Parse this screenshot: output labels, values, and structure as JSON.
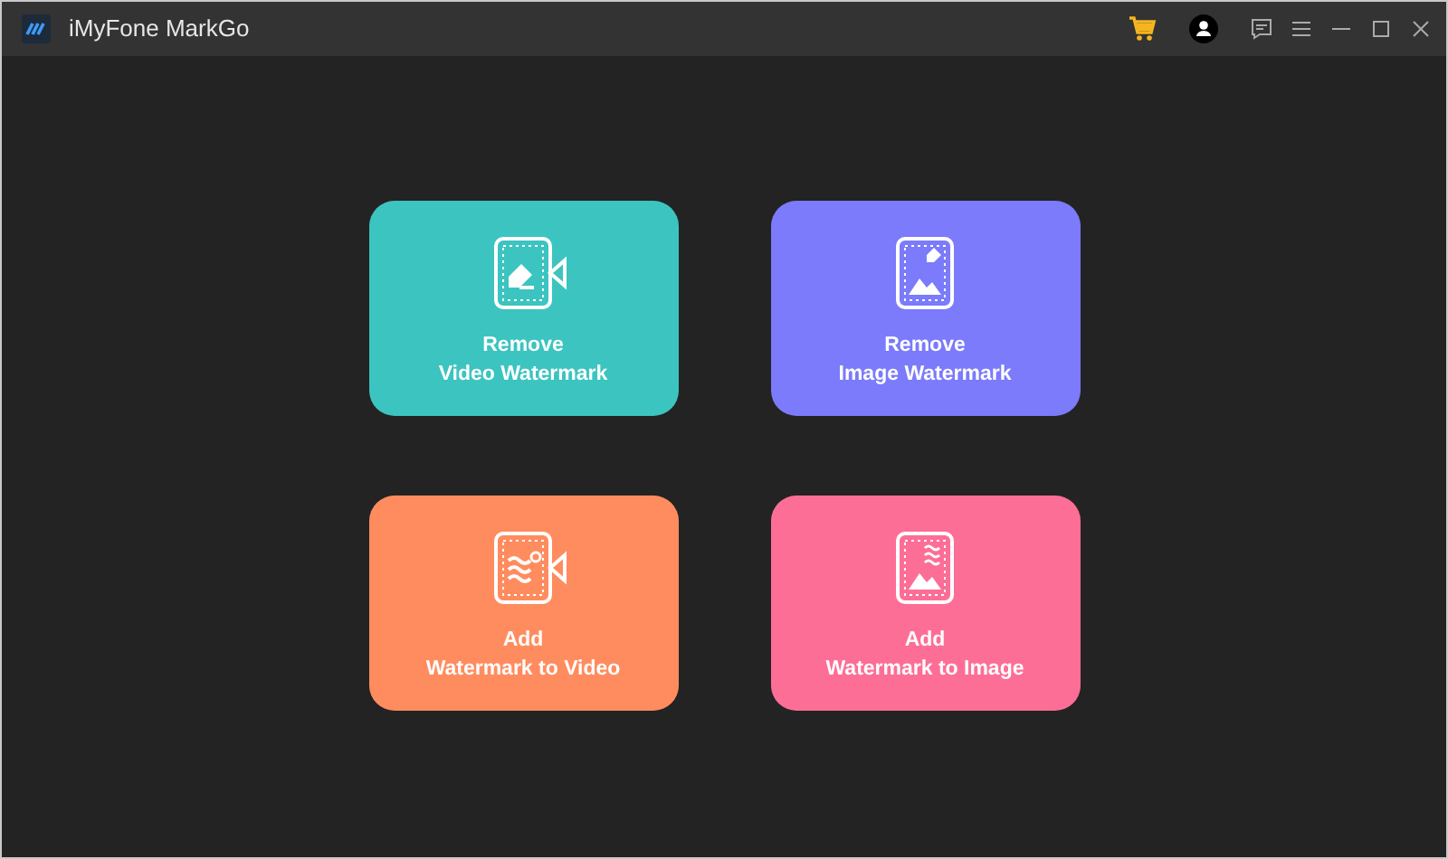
{
  "window": {
    "title": "iMyFone MarkGo"
  },
  "cards": [
    {
      "kind": "remove-video",
      "color": "#3cc4c0",
      "action": "Remove",
      "target": "Video Watermark"
    },
    {
      "kind": "remove-image",
      "color": "#7b7bfb",
      "action": "Remove",
      "target": "Image Watermark"
    },
    {
      "kind": "add-video",
      "color": "#ff8c5f",
      "action": "Add",
      "target": "Watermark to Video"
    },
    {
      "kind": "add-image",
      "color": "#fd6e97",
      "action": "Add",
      "target": "Watermark to Image"
    }
  ]
}
